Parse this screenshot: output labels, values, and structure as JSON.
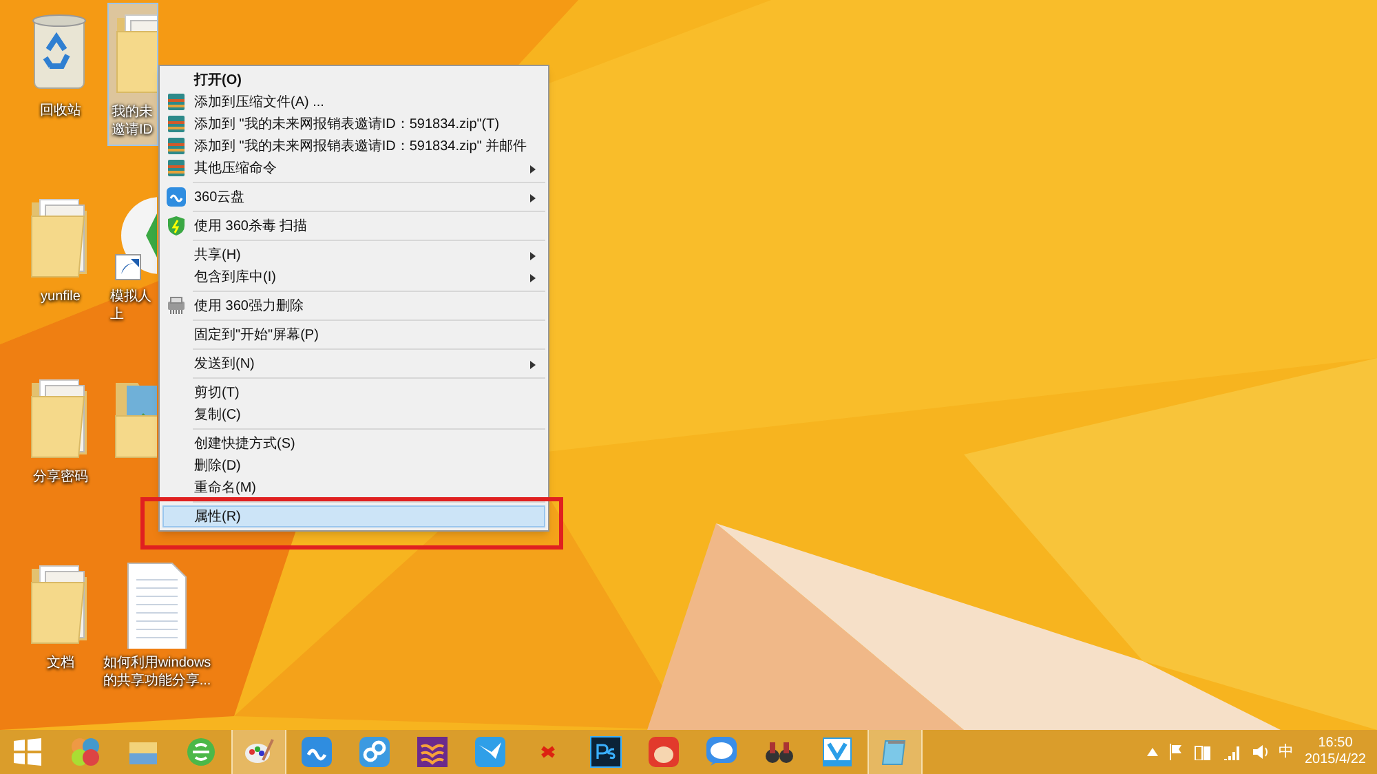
{
  "desktop_icons": [
    {
      "kind": "recycle_bin",
      "lines": [
        "回收站"
      ],
      "selected": false
    },
    {
      "kind": "folder",
      "lines": [
        "我的未",
        "邀请ID"
      ],
      "selected": true
    },
    {
      "kind": "folder",
      "lines": [
        "yunfile"
      ],
      "selected": false
    },
    {
      "kind": "app",
      "lines": [
        "模拟人",
        "上"
      ],
      "selected": false
    },
    {
      "kind": "folder",
      "lines": [
        "分享密码"
      ],
      "selected": false
    },
    {
      "kind": "photo_folder",
      "selected": false
    },
    {
      "kind": "folder",
      "lines": [
        "文档"
      ],
      "selected": false
    },
    {
      "kind": "text_file",
      "lines": [
        "如何利用windows",
        "的共享功能分享..."
      ],
      "selected": false
    }
  ],
  "context_menu": {
    "groups": [
      [
        {
          "label": "打开(O)",
          "default": true,
          "submenu": false,
          "selected": false
        },
        {
          "label": "添加到压缩文件(A) ...",
          "default": false,
          "submenu": false,
          "selected": false
        },
        {
          "label": "添加到 \"我的未来网报销表邀请ID：591834.zip\"(T)",
          "default": false,
          "submenu": false,
          "selected": false
        },
        {
          "label": "添加到 \"我的未来网报销表邀请ID：591834.zip\" 并邮件",
          "default": false,
          "submenu": false,
          "selected": false
        },
        {
          "label": "其他压缩命令",
          "default": false,
          "submenu": true,
          "selected": false
        }
      ],
      [
        {
          "label": "360云盘",
          "default": false,
          "submenu": true,
          "selected": false
        }
      ],
      [
        {
          "label": "使用 360杀毒 扫描",
          "default": false,
          "submenu": false,
          "selected": false
        }
      ],
      [
        {
          "label": "共享(H)",
          "default": false,
          "submenu": true,
          "selected": false
        },
        {
          "label": "包含到库中(I)",
          "default": false,
          "submenu": true,
          "selected": false
        }
      ],
      [
        {
          "label": "使用 360强力删除",
          "default": false,
          "submenu": false,
          "selected": false
        }
      ],
      [
        {
          "label": "固定到\"开始\"屏幕(P)",
          "default": false,
          "submenu": false,
          "selected": false
        }
      ],
      [
        {
          "label": "发送到(N)",
          "default": false,
          "submenu": true,
          "selected": false
        }
      ],
      [
        {
          "label": "剪切(T)",
          "default": false,
          "submenu": false,
          "selected": false
        },
        {
          "label": "复制(C)",
          "default": false,
          "submenu": false,
          "selected": false
        }
      ],
      [
        {
          "label": "创建快捷方式(S)",
          "default": false,
          "submenu": false,
          "selected": false
        },
        {
          "label": "删除(D)",
          "default": false,
          "submenu": false,
          "selected": false
        },
        {
          "label": "重命名(M)",
          "default": false,
          "submenu": false,
          "selected": false
        }
      ],
      [
        {
          "label": "属性(R)",
          "default": false,
          "submenu": false,
          "selected": true
        }
      ]
    ]
  },
  "taskbar": {
    "apps": [
      {
        "kind": "start",
        "active": false
      },
      {
        "kind": "circles",
        "active": false
      },
      {
        "kind": "explorer",
        "active": false
      },
      {
        "kind": "green_e",
        "active": false
      },
      {
        "kind": "paint",
        "active": true
      },
      {
        "kind": "cloud",
        "active": false
      },
      {
        "kind": "link",
        "active": false
      },
      {
        "kind": "book",
        "active": false
      },
      {
        "kind": "bird",
        "active": false
      },
      {
        "kind": "x",
        "active": false
      },
      {
        "kind": "ps",
        "active": false
      },
      {
        "kind": "bull",
        "active": false
      },
      {
        "kind": "qt",
        "active": false
      },
      {
        "kind": "binoculars",
        "active": false
      },
      {
        "kind": "v",
        "active": false
      },
      {
        "kind": "notepad",
        "active": true
      }
    ],
    "tray": {
      "ime": "中",
      "time": "16:50",
      "date": "2015/4/22"
    }
  }
}
